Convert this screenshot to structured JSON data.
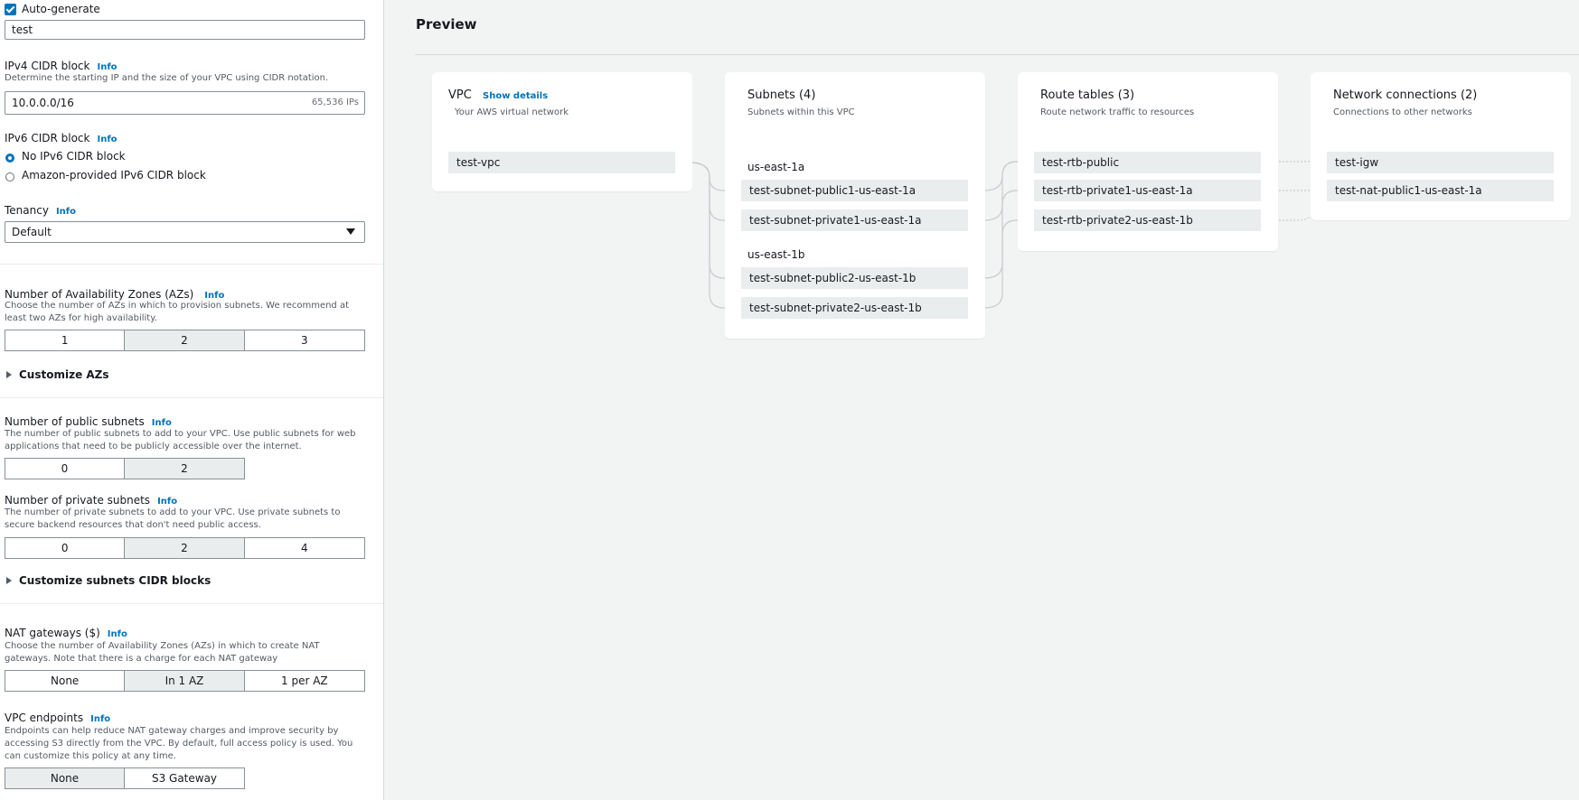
{
  "left": {
    "auto_generate": {
      "label": "Auto-generate",
      "checked": true
    },
    "name_tag_value": "test",
    "ipv4": {
      "label": "IPv4 CIDR block",
      "info": "Info",
      "description": "Determine the starting IP and the size of your VPC using CIDR notation.",
      "value": "10.0.0.0/16",
      "ips": "65,536 IPs"
    },
    "ipv6": {
      "label": "IPv6 CIDR block",
      "info": "Info",
      "options": [
        "No IPv6 CIDR block",
        "Amazon-provided IPv6 CIDR block"
      ],
      "selected_index": 0
    },
    "tenancy": {
      "label": "Tenancy",
      "info": "Info",
      "value": "Default"
    },
    "azs": {
      "label": "Number of Availability Zones (AZs)",
      "info": "Info",
      "description": "Choose the number of AZs in which to provision subnets. We recommend at least two AZs for high availability.",
      "options": [
        "1",
        "2",
        "3"
      ],
      "selected": "2"
    },
    "customize_azs": "Customize AZs",
    "public_subnets": {
      "label": "Number of public subnets",
      "info": "Info",
      "description": "The number of public subnets to add to your VPC. Use public subnets for web applications that need to be publicly accessible over the internet.",
      "options": [
        "0",
        "2"
      ],
      "selected": "2"
    },
    "private_subnets": {
      "label": "Number of private subnets",
      "info": "Info",
      "description": "The number of private subnets to add to your VPC. Use private subnets to secure backend resources that don't need public access.",
      "options": [
        "0",
        "2",
        "4"
      ],
      "selected": "2"
    },
    "customize_cidr": "Customize subnets CIDR blocks",
    "nat": {
      "label": "NAT gateways ($)",
      "info": "Info",
      "description": "Choose the number of Availability Zones (AZs) in which to create NAT gateways. Note that there is a charge for each NAT gateway",
      "options": [
        "None",
        "In 1 AZ",
        "1 per AZ"
      ],
      "selected": "In 1 AZ"
    },
    "endpoints": {
      "label": "VPC endpoints",
      "info": "Info",
      "description": "Endpoints can help reduce NAT gateway charges and improve security by accessing S3 directly from the VPC. By default, full access policy is used. You can customize this policy at any time.",
      "options": [
        "None",
        "S3 Gateway"
      ],
      "selected": "None"
    }
  },
  "preview": {
    "title": "Preview",
    "vpc": {
      "title": "VPC",
      "show_details": "Show details",
      "subtitle": "Your AWS virtual network",
      "items": [
        "test-vpc"
      ]
    },
    "subnets": {
      "title": "Subnets (4)",
      "subtitle": "Subnets within this VPC",
      "groups": [
        {
          "az": "us-east-1a",
          "items": [
            "test-subnet-public1-us-east-1a",
            "test-subnet-private1-us-east-1a"
          ]
        },
        {
          "az": "us-east-1b",
          "items": [
            "test-subnet-public2-us-east-1b",
            "test-subnet-private2-us-east-1b"
          ]
        }
      ]
    },
    "route_tables": {
      "title": "Route tables (3)",
      "subtitle": "Route network traffic to resources",
      "items": [
        "test-rtb-public",
        "test-rtb-private1-us-east-1a",
        "test-rtb-private2-us-east-1b"
      ]
    },
    "network_connections": {
      "title": "Network connections (2)",
      "subtitle": "Connections to other networks",
      "items": [
        "test-igw",
        "test-nat-public1-us-east-1a"
      ]
    }
  },
  "colors": {
    "link": "#0073bb",
    "line": "#c7cccf",
    "selected_segment": "#eaeded",
    "preview_bg": "#f2f3f3"
  }
}
